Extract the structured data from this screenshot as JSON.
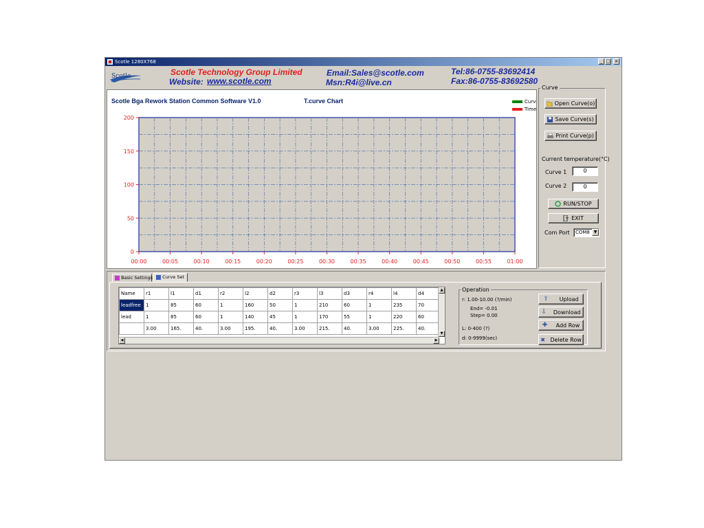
{
  "window": {
    "title": "Scotle 1280X768",
    "minimize": "_",
    "maximize": "□",
    "close": "×"
  },
  "logo": {
    "text": "Scotle"
  },
  "header": {
    "company": "Scotle Technology Group Limited",
    "website_label": "Website:",
    "website": "www.scotle.com",
    "email": "Email:Sales@scotle.com",
    "msn": "Msn:R4i@live.cn",
    "tel": "Tel:86-0755-83692414",
    "fax": "Fax:86-0755-83692580"
  },
  "chart_panel": {
    "software_title": "Scotle Bga Rework Station Common Software V1.0",
    "chart_title": "T.curve  Chart"
  },
  "chart_data": {
    "type": "line",
    "title": "T.curve  Chart",
    "x_ticks": [
      "00:00",
      "00:05",
      "00:10",
      "00:15",
      "00:20",
      "00:25",
      "00:30",
      "00:35",
      "00:40",
      "00:45",
      "00:50",
      "00:55",
      "01:00"
    ],
    "y_ticks": [
      0,
      50,
      100,
      150,
      200
    ],
    "ylim": [
      0,
      200
    ],
    "grid": true,
    "legend_position": "top-right",
    "series": [
      {
        "name": "Curve",
        "color": "#008000",
        "values": []
      },
      {
        "name": "Time",
        "color": "#e02020",
        "values": []
      }
    ]
  },
  "curve_group": {
    "caption": "Curve",
    "open": "Open Curve(o)",
    "save": "Save Curve(s)",
    "print": "Print Curve(p)",
    "temp_label": "Current temperature(°C)",
    "curve1_label": "Curve  1",
    "curve1_value": "0",
    "curve2_label": "Curve  2",
    "curve2_value": "0",
    "run_stop": "RUN/STOP",
    "exit": "EXIT",
    "com_label": "Com Port",
    "com_value": "COM8"
  },
  "tabs": [
    {
      "label": "Basic Settings",
      "active": false
    },
    {
      "label": "Curve Set",
      "active": true
    }
  ],
  "table": {
    "headers": [
      "Name",
      "r1",
      "l1",
      "d1",
      "r2",
      "l2",
      "d2",
      "r3",
      "l3",
      "d3",
      "r4",
      "l4",
      "d4"
    ],
    "rows": [
      [
        "leadfree",
        "1",
        "85",
        "60",
        "1",
        "160",
        "50",
        "1",
        "210",
        "60",
        "1",
        "235",
        "70"
      ],
      [
        "lead",
        "1",
        "85",
        "60",
        "1",
        "140",
        "45",
        "1",
        "170",
        "55",
        "1",
        "220",
        "60"
      ],
      [
        "",
        "3.00",
        "165.",
        "40.",
        "3.00",
        "195.",
        "40.",
        "3.00",
        "215.",
        "40.",
        "3.00",
        "225.",
        "40."
      ]
    ]
  },
  "operation": {
    "caption": "Operation",
    "r_range": "r: 1.00-10.00 (?/min)",
    "end": "End=  -0.01",
    "step": "Step= 0.00",
    "l_range": "L:  0-400 (?)",
    "d_range": "d: 0-9999(sec)",
    "upload": "Upload",
    "download": "Download",
    "add_row": "Add Row",
    "delete_row": "Delete Row"
  }
}
